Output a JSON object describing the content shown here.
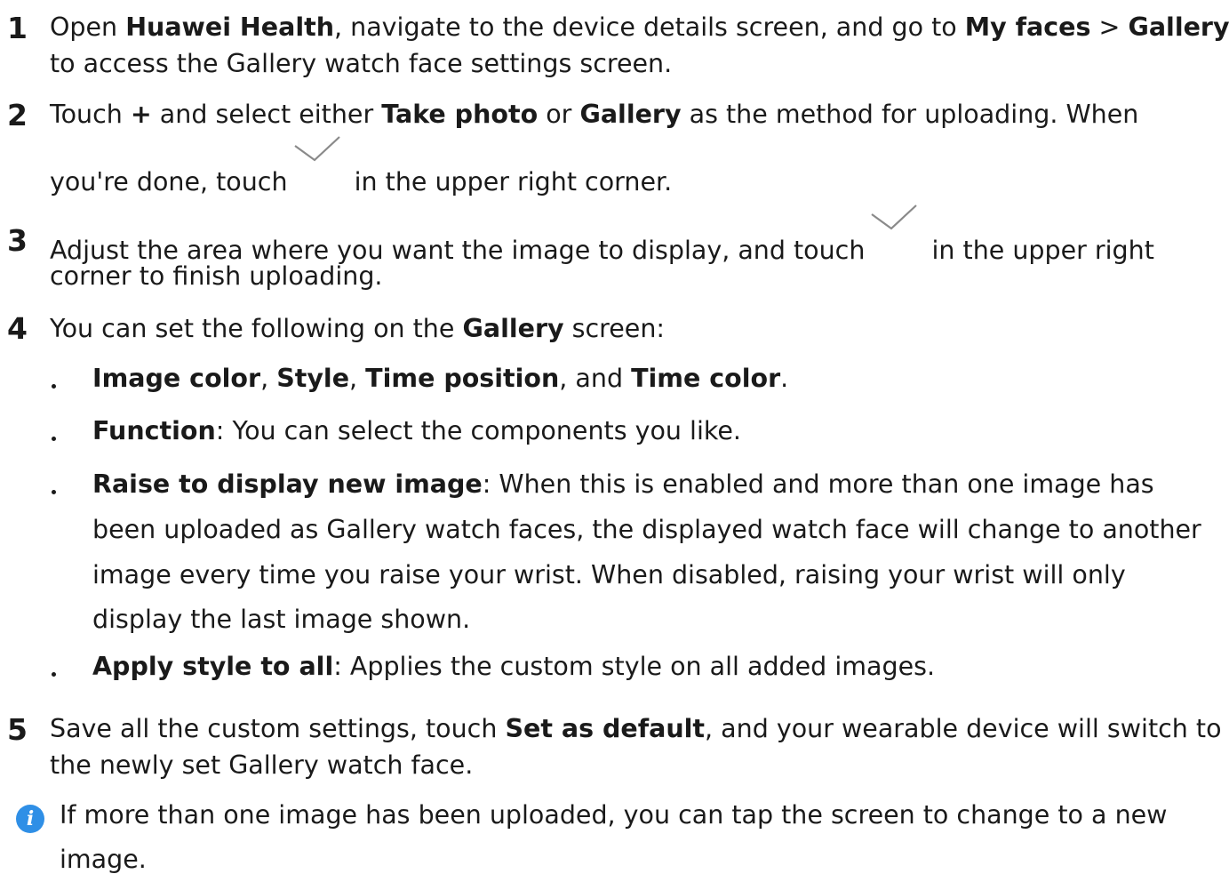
{
  "steps": [
    {
      "number": "1",
      "lines": [
        {
          "a": "Open ",
          "b": "Huawei Health",
          "c": ", navigate to the device details screen, and go to ",
          "d": "My faces",
          "e": " > ",
          "f": "Gallery"
        },
        {
          "text": "to access the Gallery watch face settings screen."
        }
      ]
    },
    {
      "number": "2",
      "line1": {
        "a": "Touch ",
        "b": "+",
        "c": " and select either ",
        "d": "Take photo",
        "e": " or ",
        "f": "Gallery",
        "g": " as the method for uploading. When"
      },
      "line2": {
        "a": "you're done, touch",
        "b": " in the upper right corner."
      }
    },
    {
      "number": "3",
      "line1": {
        "a": "Adjust the area where you want the image to display, and touch",
        "b": " in the upper right"
      },
      "line2": "corner to finish uploading."
    },
    {
      "number": "4",
      "line1": {
        "a": "You can set the following on the ",
        "b": "Gallery",
        "c": " screen:"
      },
      "bullets": [
        {
          "b1": "Image color",
          "t1": ", ",
          "b2": "Style",
          "t2": ", ",
          "b3": "Time position",
          "t3": ", and ",
          "b4": "Time color",
          "t4": "."
        },
        {
          "b1": "Function",
          "t1": ": You can select the components you like."
        },
        {
          "b1": "Raise to display new image",
          "t1": ": When this is enabled and more than one image has",
          "l2": "been uploaded as Gallery watch faces, the displayed watch face will change to another",
          "l3": "image every time you raise your wrist. When disabled, raising your wrist will only",
          "l4": "display the last image shown."
        },
        {
          "b1": "Apply style to all",
          "t1": ": Applies the custom style on all added images."
        }
      ]
    },
    {
      "number": "5",
      "line1": {
        "a": "Save all the custom settings, touch ",
        "b": "Set as default",
        "c": ", and your wearable device will switch to"
      },
      "line2": "the newly set Gallery watch face."
    }
  ],
  "note": {
    "icon": "info-icon",
    "line1": "If more than one image has been uploaded, you can tap the screen to change to a new",
    "line2": "image."
  },
  "colors": {
    "text": "#1a1a1a",
    "info_icon": "#2f8fe6",
    "checkmark": "#8a8a8a"
  }
}
